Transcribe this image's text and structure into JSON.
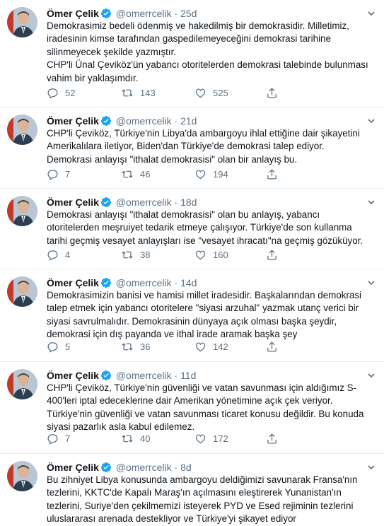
{
  "author": {
    "name": "Ömer Çelik",
    "handle": "@omerrcelik",
    "verified": true
  },
  "colors": {
    "text": "#0f1419",
    "secondary": "#5b7083",
    "verified": "#1da1f2",
    "divider": "#e6ecf0"
  },
  "icons": {
    "reply": "reply-icon",
    "retweet": "retweet-icon",
    "like": "like-icon",
    "share": "share-icon",
    "more": "chevron-down-icon",
    "verified": "verified-badge-icon"
  },
  "tweets": [
    {
      "time": "25d",
      "text": "Demokrasimiz bedeli ödenmiş ve hakedilmiş bir demokrasidir. Milletimiz,\niradesinin kimse tarafından gaspedilemeyeceğini demokrasi tarihine\nsilinmeyecek şekilde yazmıştır.\nCHP'li Ünal Çeviköz'ün yabancı otoritelerden demokrasi talebinde bulunması\nvahim bir yaklaşımdır.",
      "replies": "52",
      "retweets": "143",
      "likes": "525"
    },
    {
      "time": "21d",
      "text": "CHP'li Çeviköz, Türkiye'nin Libya'da ambargoyu ihlal ettiğine dair şikayetini\nAmerikalılara iletiyor, Biden'dan Türkiye'de demokrasi talep ediyor.\nDemokrasi anlayışı \"ithalat demokrasisi\" olan bir anlayış bu.",
      "replies": "7",
      "retweets": "46",
      "likes": "194"
    },
    {
      "time": "18d",
      "text": "Demokrasi anlayışı \"ithalat demokrasisi\" olan bu anlayış, yabancı\notoritelerden meşruiyet tedarik etmeye çalışıyor. Türkiye'de son kullanma\ntarihi geçmiş vesayet anlayışları ise \"vesayet ihracatı\"na geçmiş gözüküyor.",
      "replies": "4",
      "retweets": "38",
      "likes": "160"
    },
    {
      "time": "14d",
      "text": "Demokrasimizin banisi ve hamisi millet iradesidir. Başkalarından demokrasi\ntalep etmek için yabancı otoritelere \"siyasi arzuhal\" yazmak utanç verici bir\nsiyasi savrulmalıdır. Demokrasinin dünyaya açık olması başka şeydir,\ndemokrasi için dış payanda ve ithal irade aramak başka şey",
      "replies": "5",
      "retweets": "36",
      "likes": "142"
    },
    {
      "time": "11d",
      "text": "CHP'li Çeviköz, Türkiye'nin güvenliği ve vatan savunması için aldığımız S-\n400'leri iptal edeceklerine dair Amerikan yönetimine açık çek veriyor.\nTürkiye'nin güvenliği ve vatan savunması ticaret konusu değildir. Bu konuda\nsiyasi pazarlık asla kabul edilemez.",
      "replies": "7",
      "retweets": "40",
      "likes": "172"
    },
    {
      "time": "8d",
      "text": "Bu zihniyet Libya konusunda ambargoyu deldiğimizi savunarak Fransa'nın\ntezlerini, KKTC'de Kapalı Maraş'ın açılmasını eleştirerek Yunanistan'ın\ntezlerini, Suriye'den çekilmemizi isteyerek PYD ve Esed rejiminin tezlerini\nuluslararası arenada destekliyor ve Türkiye'yi şikayet ediyor"
    }
  ]
}
